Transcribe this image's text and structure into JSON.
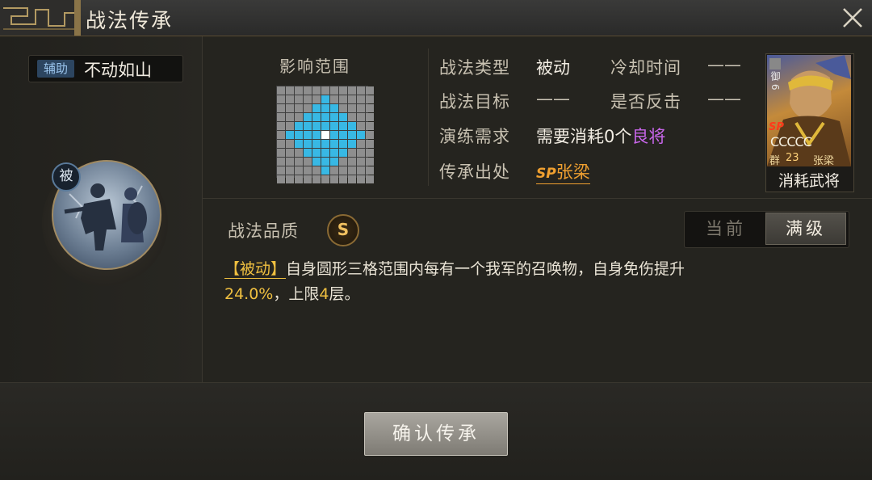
{
  "window": {
    "title": "战法传承",
    "close_icon": "close-icon"
  },
  "skill": {
    "tag": "辅助",
    "name": "不动如山",
    "passive_badge": "被",
    "portrait_icon": "warrior-portrait-icon"
  },
  "range": {
    "label": "影响范围",
    "grid_size": 11,
    "blue_cells": [
      [
        1,
        5
      ],
      [
        2,
        4
      ],
      [
        2,
        5
      ],
      [
        2,
        6
      ],
      [
        3,
        3
      ],
      [
        3,
        4
      ],
      [
        3,
        5
      ],
      [
        3,
        6
      ],
      [
        3,
        7
      ],
      [
        4,
        2
      ],
      [
        4,
        3
      ],
      [
        4,
        4
      ],
      [
        4,
        5
      ],
      [
        4,
        6
      ],
      [
        4,
        7
      ],
      [
        4,
        8
      ],
      [
        5,
        1
      ],
      [
        5,
        2
      ],
      [
        5,
        3
      ],
      [
        5,
        4
      ],
      [
        5,
        6
      ],
      [
        5,
        7
      ],
      [
        5,
        8
      ],
      [
        5,
        9
      ],
      [
        6,
        2
      ],
      [
        6,
        3
      ],
      [
        6,
        4
      ],
      [
        6,
        5
      ],
      [
        6,
        6
      ],
      [
        6,
        7
      ],
      [
        6,
        8
      ],
      [
        7,
        3
      ],
      [
        7,
        4
      ],
      [
        7,
        5
      ],
      [
        7,
        6
      ],
      [
        7,
        7
      ],
      [
        8,
        4
      ],
      [
        8,
        5
      ],
      [
        8,
        6
      ],
      [
        9,
        5
      ]
    ],
    "center_cell": [
      5,
      5
    ]
  },
  "info": {
    "type_label": "战法类型",
    "type_value": "被动",
    "cooldown_label": "冷却时间",
    "cooldown_value": "——",
    "target_label": "战法目标",
    "target_value": "——",
    "counter_label": "是否反击",
    "counter_value": "——",
    "req_label": "演练需求",
    "req_prefix": "需要消耗",
    "req_count": "0",
    "req_unit": "个",
    "req_quality": "良将",
    "source_label": "传承出处",
    "source_sp": "SP",
    "source_name": "张梁"
  },
  "card": {
    "cost": "御 6",
    "sp": "SP",
    "stars": "CCCCC",
    "faction": "群",
    "level": "23",
    "name": "张梁",
    "caption": "消耗武将"
  },
  "quality": {
    "label": "战法品质",
    "grade": "S"
  },
  "toggle": {
    "current": "当前",
    "max": "满级"
  },
  "description": {
    "tag": "【被动】",
    "text1": "自身圆形三格范围内每有一个我军的召唤物，自身免伤提升",
    "value": "24.0%",
    "text2": "，上限",
    "limit": "4",
    "text3": "层。"
  },
  "footer": {
    "confirm": "确认传承"
  },
  "colors": {
    "range_blue": "#38b8e4",
    "purple": "#c866ea",
    "orange": "#f0a030",
    "gold": "#f0c040"
  }
}
